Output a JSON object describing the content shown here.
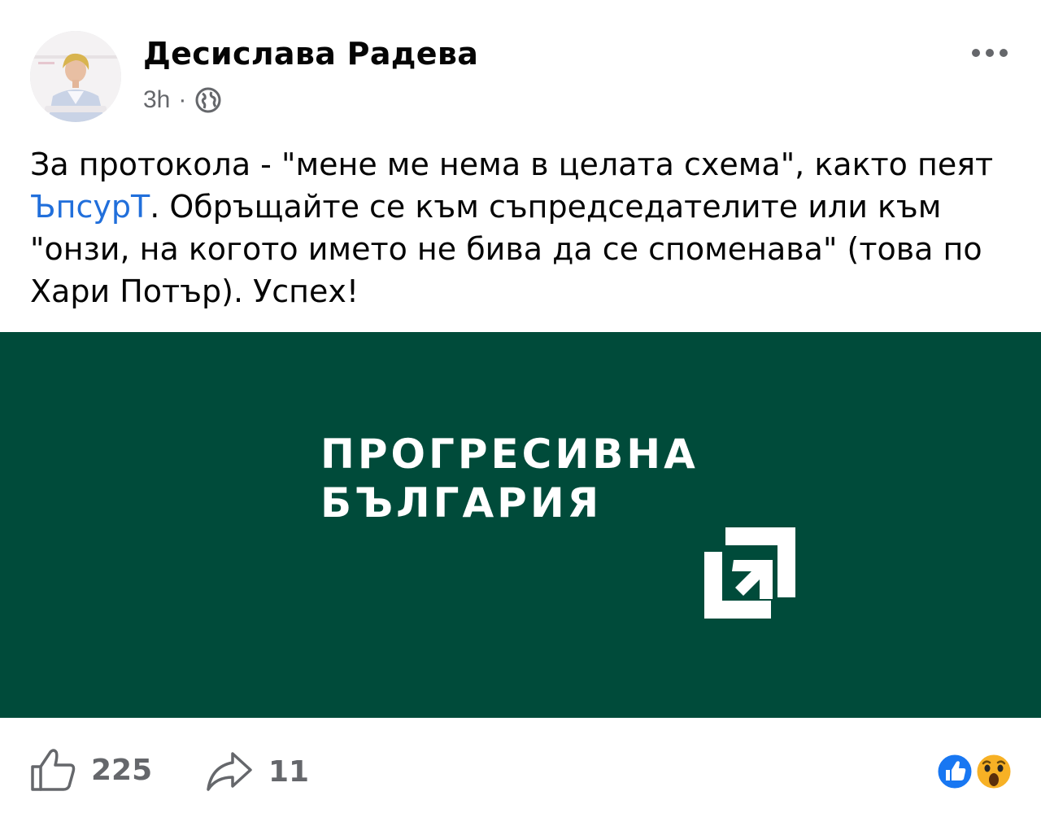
{
  "post": {
    "author_name": "Десислава Радева",
    "time": "3h",
    "separator": "·",
    "privacy_icon": "globe-icon",
    "more_icon": "more-dots-icon",
    "text": {
      "part1": "За протокола - \"мене ме нема в целата схема\", както пеят ",
      "mention": "ЪпсурТ",
      "part2": ". Обръщайте се към съпредседателите или към \"онзи, на когото името не бива да се споменава\" (това по Хари Потър). Успех!"
    }
  },
  "image": {
    "brand_line1": "ПРОГРЕСИВНА",
    "brand_line2": "БЪЛГАРИЯ",
    "background_color": "#004b3a"
  },
  "footer": {
    "likes_count": "225",
    "shares_count": "11",
    "like_icon": "thumbs-up-icon",
    "share_icon": "share-arrow-icon",
    "reactions": [
      "like-reaction-icon",
      "wow-reaction-icon"
    ]
  },
  "colors": {
    "text": "#050505",
    "secondary_text": "#65676b",
    "link": "#216fdb",
    "reaction_blue": "#1877f2",
    "reaction_yellow": "#f7b125"
  }
}
